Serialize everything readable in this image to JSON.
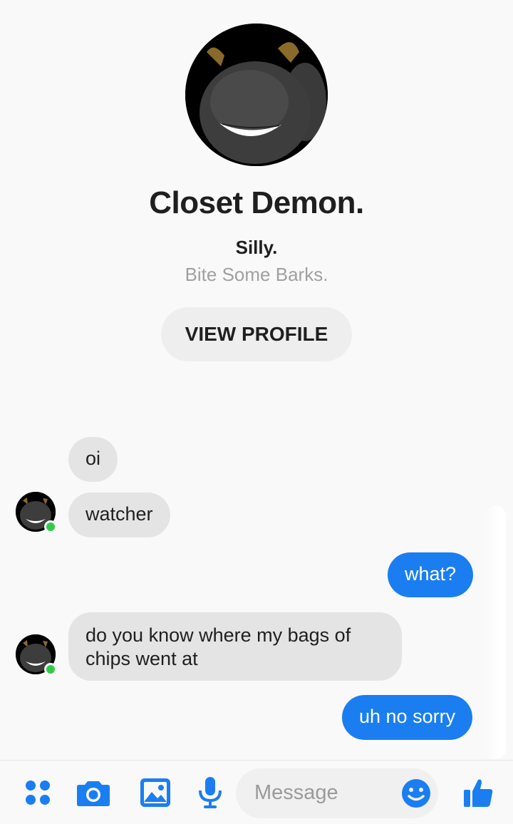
{
  "profile": {
    "name": "Closet Demon.",
    "subtitle": "Silly.",
    "bio": "Bite Some Barks.",
    "view_profile_label": "VIEW PROFILE"
  },
  "messages": [
    {
      "sender": "contact",
      "text": "oi"
    },
    {
      "sender": "contact",
      "text": "watcher"
    },
    {
      "sender": "me",
      "text": "what?"
    },
    {
      "sender": "contact",
      "text": "do you know where my bags of chips went at"
    },
    {
      "sender": "me",
      "text": "uh no sorry"
    }
  ],
  "composer": {
    "placeholder": "Message",
    "icons": [
      "apps-icon",
      "camera-icon",
      "gallery-icon",
      "microphone-icon",
      "emoji-icon",
      "thumbs-up-icon"
    ]
  },
  "colors": {
    "accent": "#1a7ef0",
    "incoming_bubble": "#e4e4e4",
    "online": "#31cc46"
  }
}
